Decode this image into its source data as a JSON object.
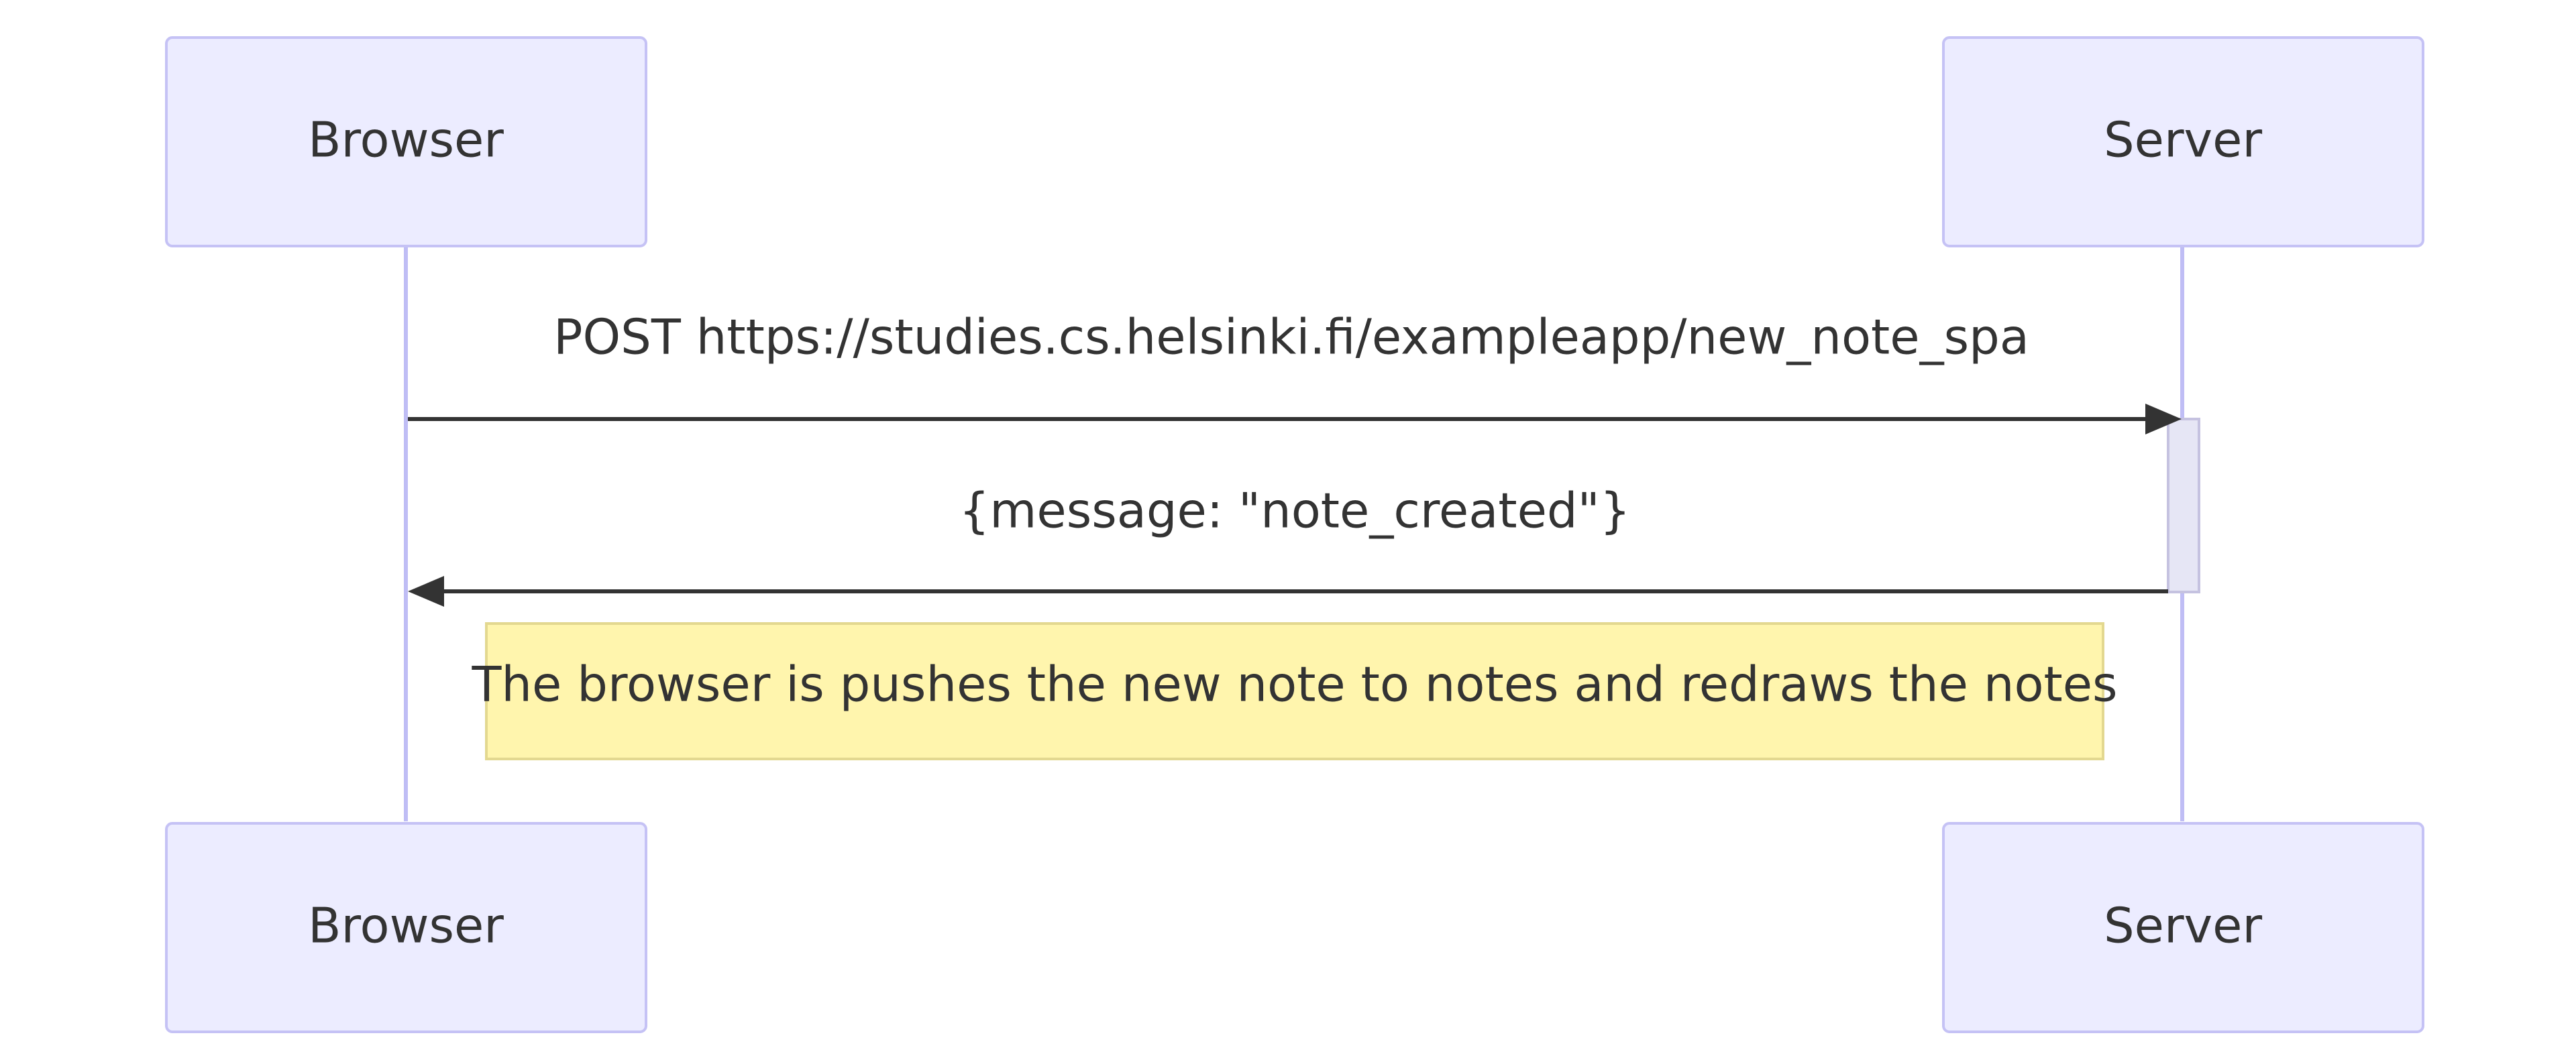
{
  "diagram": {
    "type": "sequence",
    "participants": [
      {
        "id": "browser",
        "label": "Browser"
      },
      {
        "id": "server",
        "label": "Server"
      }
    ],
    "messages": [
      {
        "from": "browser",
        "to": "server",
        "label": "POST https://studies.cs.helsinki.fi/exampleapp/new_note_spa"
      },
      {
        "from": "server",
        "to": "browser",
        "label": "{message: \"note_created\"}"
      }
    ],
    "note": {
      "text": "The browser is pushes the new note to notes and redraws the notes"
    }
  },
  "colors": {
    "actor_fill": "#ECECFF",
    "actor_border": "#C5C2F5",
    "lifeline": "#BFBDF5",
    "note_fill": "#FFF5AD",
    "note_border": "#E3D890",
    "arrow": "#333333",
    "text": "#333333"
  }
}
